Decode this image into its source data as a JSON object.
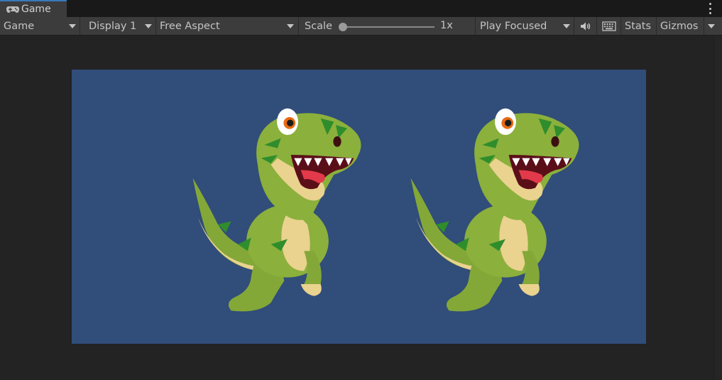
{
  "tab": {
    "title": "Game",
    "icon": "gamepad-icon"
  },
  "menu": {
    "icon": "kebab-menu-icon"
  },
  "toolbar": {
    "view_mode": "Game",
    "display": "Display 1",
    "aspect": "Free Aspect",
    "scale_label": "Scale",
    "scale_value": "1x",
    "play_mode": "Play Focused",
    "audio_icon": "speaker-icon",
    "stats_icon": "keyboard-icon",
    "stats_label": "Stats",
    "gizmos_label": "Gizmos"
  },
  "scene": {
    "background_color": "#314d79",
    "sprites": [
      "dinosaur-sprite",
      "dinosaur-sprite"
    ]
  }
}
